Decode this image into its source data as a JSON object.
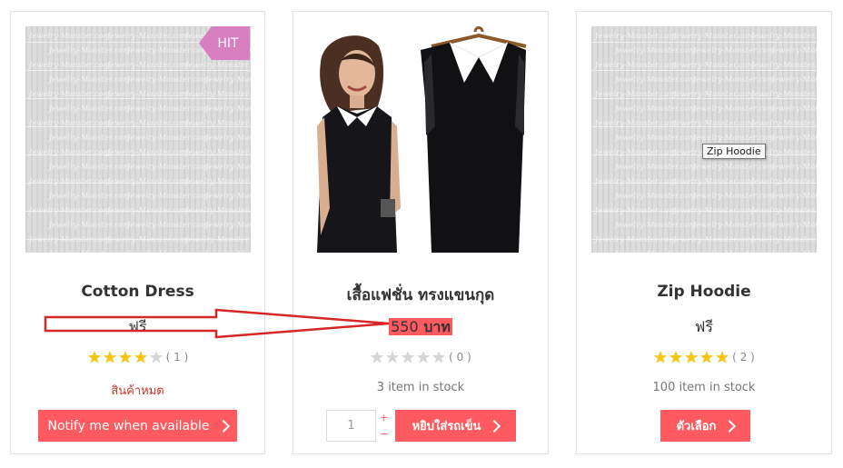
{
  "products": [
    {
      "badge": "HIT",
      "title": "Cotton Dress",
      "price": "ฟรี",
      "rating_count": "( 1 )",
      "stars_filled": 4,
      "stock": "สินค้าหมด",
      "button": "Notify me when available"
    },
    {
      "title": "เสื้อแฟชั่น ทรงแขนกุด",
      "price_number": "550",
      "price_unit": " บาท",
      "rating_count": "( 0 )",
      "stars_filled": 0,
      "stock": "3 item in stock",
      "quantity": "1",
      "qty_plus": "+",
      "qty_minus": "−",
      "button": "หยิบใส่รถเข็น"
    },
    {
      "title": "Zip Hoodie",
      "price": "ฟรี",
      "rating_count": "( 2 )",
      "stars_filled": 5,
      "stock": "100 item in stock",
      "button": "ตัวเลือก",
      "tooltip": "Zip Hoodie"
    }
  ],
  "watermark_text": "Jewelry-Monster.com",
  "colors": {
    "accent": "#ff5a5f",
    "hit_badge": "#d77fc1",
    "star_filled": "#f5c518",
    "star_empty": "#d6d6d6",
    "annotation": "#d62728"
  }
}
